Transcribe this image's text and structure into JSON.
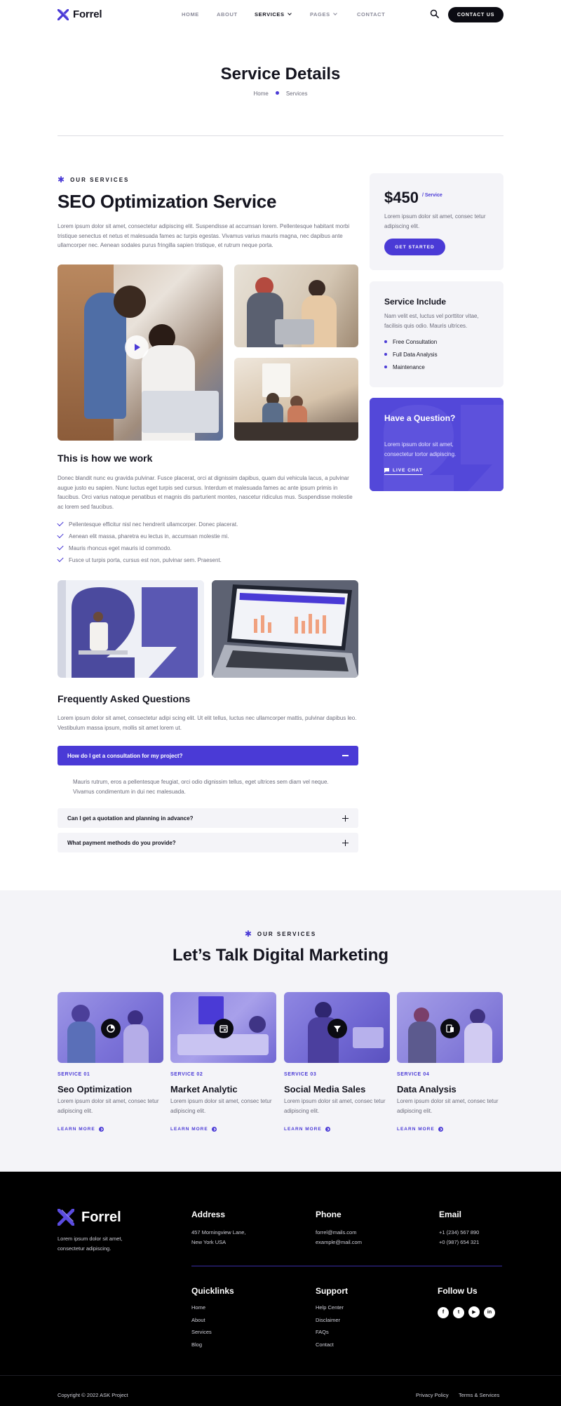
{
  "brand": {
    "name": "Forrel",
    "accent": "#4a3ad6",
    "dark": "#0b0b12",
    "soft_bg": "#f4f4f8"
  },
  "nav": {
    "items": [
      {
        "label": "HOME"
      },
      {
        "label": "ABOUT"
      },
      {
        "label": "SERVICES",
        "active": true,
        "dropdown": true
      },
      {
        "label": "PAGES",
        "dropdown": true
      },
      {
        "label": "CONTACT"
      }
    ],
    "search_icon": "search-icon",
    "contact_button": "CONTACT US"
  },
  "hero": {
    "title": "Service Details",
    "breadcrumb": [
      "Home",
      "Services"
    ]
  },
  "main": {
    "eyebrow": "OUR SERVICES",
    "title": "SEO Optimization Service",
    "intro": "Lorem ipsum dolor sit amet, consectetur adipiscing elit. Suspendisse at accumsan lorem. Pellentesque habitant morbi tristique senectus et netus et malesuada fames ac turpis egestas. Vivamus varius mauris magna, nec dapibus ante ullamcorper nec. Aenean sodales purus fringilla sapien tristique, et rutrum neque porta.",
    "how_title": "This is how we work",
    "how_text": "Donec blandit nunc eu gravida pulvinar. Fusce placerat, orci at dignissim dapibus, quam dui vehicula lacus, a pulvinar augue justo eu sapien. Nunc luctus eget turpis sed cursus. Interdum et malesuada fames ac ante ipsum primis in faucibus. Orci varius natoque penatibus et magnis dis parturient montes, nascetur ridiculus mus. Suspendisse molestie ac lorem sed faucibus.",
    "checks": [
      "Pellentesque efficitur nisl nec hendrerit ullamcorper. Donec placerat.",
      "Aenean elit massa, pharetra eu lectus in, accumsan molestie mi.",
      "Mauris rhoncus eget mauris id commodo.",
      "Fusce ut turpis porta, cursus est non, pulvinar sem. Praesent."
    ],
    "faq_title": "Frequently Asked Questions",
    "faq_intro": "Lorem ipsum dolor sit amet, consectetur adipi scing elit. Ut elit tellus, luctus nec ullamcorper mattis, pulvinar dapibus leo. Vestibulum massa ipsum, mollis sit amet lorem ut.",
    "faqs": [
      {
        "q": "How do I get a consultation for my project?",
        "a": "Mauris rutrum, eros a pellentesque feugiat, orci odio dignissim tellus, eget ultrices sem diam vel neque. Vivamus condimentum in dui nec malesuada.",
        "open": true
      },
      {
        "q": "Can I get a quotation and planning in advance?",
        "open": false
      },
      {
        "q": "What payment methods do you provide?",
        "open": false
      }
    ]
  },
  "sidebar": {
    "price": "$450",
    "price_unit": "/ Service",
    "price_text": "Lorem ipsum dolor sit amet, consec tetur adipiscing elit.",
    "get_started": "GET STARTED",
    "include_title": "Service Include",
    "include_text": "Nam velit est, luctus vel porttitor vitae, facilisis quis odio. Mauris ultrices.",
    "include_items": [
      "Free Consultation",
      "Full Data Analysis",
      "Maintenance"
    ],
    "question_title": "Have a Question?",
    "question_text": "Lorem ipsum dolor sit amet, consectetur tortor adipiscing.",
    "live_chat": "LIVE CHAT"
  },
  "services": {
    "eyebrow": "OUR SERVICES",
    "title": "Let’s Talk Digital Marketing",
    "items": [
      {
        "label": "SERVICE 01",
        "title": "Seo Optimization",
        "desc": "Lorem ipsum dolor sit amet, consec tetur adipiscing elit.",
        "more": "LEARN MORE",
        "icon": "pie-chart-icon"
      },
      {
        "label": "SERVICE 02",
        "title": "Market Analytic",
        "desc": "Lorem ipsum dolor sit amet, consec tetur adipiscing elit.",
        "more": "LEARN MORE",
        "icon": "calendar-icon"
      },
      {
        "label": "SERVICE 03",
        "title": "Social Media Sales",
        "desc": "Lorem ipsum dolor sit amet, consec tetur adipiscing elit.",
        "more": "LEARN MORE",
        "icon": "filter-icon"
      },
      {
        "label": "SERVICE 04",
        "title": "Data Analysis",
        "desc": "Lorem ipsum dolor sit amet, consec tetur adipiscing elit.",
        "more": "LEARN MORE",
        "icon": "devices-icon"
      }
    ]
  },
  "footer": {
    "brand": "Forrel",
    "tagline": "Lorem ipsum dolor sit amet, consectetur adipiscing.",
    "address_title": "Address",
    "address": [
      "457 Morningview Lane,",
      "New York USA"
    ],
    "phone_title": "Phone",
    "phone": [
      "forrel@mails.com",
      "example@mail.com"
    ],
    "email_title": "Email",
    "email": [
      "+1 (234) 567 890",
      "+0 (987) 654 321"
    ],
    "quicklinks_title": "Quicklinks",
    "quicklinks": [
      "Home",
      "About",
      "Services",
      "Blog"
    ],
    "support_title": "Support",
    "support": [
      "Help Center",
      "Disclaimer",
      "FAQs",
      "Contact"
    ],
    "follow_title": "Follow Us",
    "social": [
      "facebook-icon",
      "twitter-icon",
      "youtube-icon",
      "linkedin-icon"
    ],
    "copyright": "Copyright © 2022 ASK Project",
    "legal": [
      "Privacy Policy",
      "Terms & Services"
    ]
  }
}
